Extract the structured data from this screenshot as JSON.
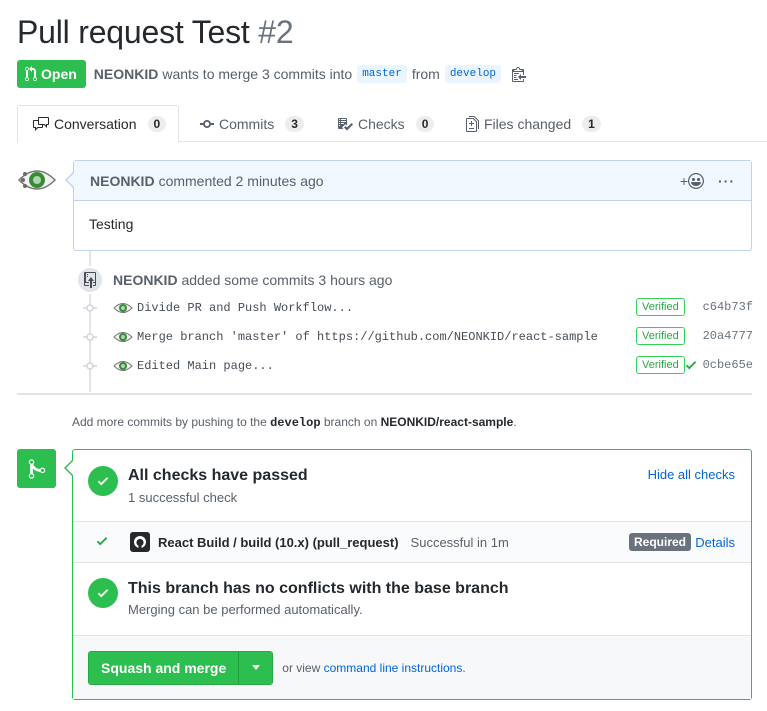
{
  "pr": {
    "title": "Pull request Test",
    "number": "#2",
    "state": "Open",
    "author": "NEONKID",
    "merge_text": "wants to merge 3 commits into",
    "base_branch": "master",
    "from_text": "from",
    "head_branch": "develop"
  },
  "tabs": [
    {
      "label": "Conversation",
      "count": "0",
      "icon": "comment-discussion-icon"
    },
    {
      "label": "Commits",
      "count": "3",
      "icon": "git-commit-icon"
    },
    {
      "label": "Checks",
      "count": "0",
      "icon": "checklist-icon"
    },
    {
      "label": "Files changed",
      "count": "1",
      "icon": "file-diff-icon"
    }
  ],
  "comment": {
    "author": "NEONKID",
    "action": "commented",
    "time": "2 minutes ago",
    "reaction_label": "+",
    "more_label": "···",
    "body": "Testing"
  },
  "commits_event": {
    "author": "NEONKID",
    "action": "added some commits",
    "time": "3 hours ago",
    "commits": [
      {
        "message": "Divide PR and Push Workflow...",
        "verified": "Verified",
        "sha": "c64b73f",
        "status": ""
      },
      {
        "message": "Merge branch 'master' of https://github.com/NEONKID/react-sample",
        "verified": "Verified",
        "sha": "20a4777",
        "status": ""
      },
      {
        "message": "Edited Main page...",
        "verified": "Verified",
        "sha": "0cbe65e",
        "status": "success"
      }
    ]
  },
  "push_hint": {
    "prefix": "Add more commits by pushing to the",
    "branch": "develop",
    "middle": "branch on",
    "repo": "NEONKID/react-sample",
    "suffix": "."
  },
  "merge_box": {
    "checks_title": "All checks have passed",
    "checks_sub": "1 successful check",
    "hide_link": "Hide all checks",
    "check": {
      "name": "React Build / build (10.x) (pull_request)",
      "description": "Successful in 1m",
      "required": "Required",
      "details": "Details"
    },
    "conflicts_title": "This branch has no conflicts with the base branch",
    "conflicts_sub": "Merging can be performed automatically.",
    "merge_button": "Squash and merge",
    "or_view": "or view",
    "cli_link": "command line instructions",
    "cli_suffix": "."
  },
  "colors": {
    "green": "#2cbe4e",
    "link": "#0366d6",
    "muted": "#586069"
  }
}
